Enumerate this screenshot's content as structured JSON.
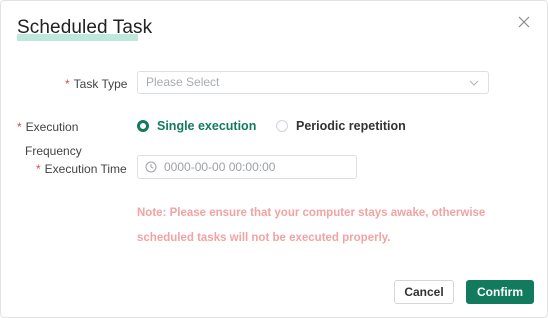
{
  "dialog": {
    "title": "Scheduled Task",
    "close_icon": "close-icon"
  },
  "form": {
    "task_type": {
      "required_mark": "*",
      "label": "Task Type",
      "placeholder": "Please Select"
    },
    "execution_frequency": {
      "required_mark": "*",
      "label_line1": "Execution",
      "label_line2": "Frequency",
      "options": [
        {
          "label": "Single execution",
          "checked": true
        },
        {
          "label": "Periodic repetition",
          "checked": false
        }
      ]
    },
    "execution_time": {
      "required_mark": "*",
      "label": "Execution Time",
      "placeholder": "0000-00-00 00:00:00"
    },
    "note_line1": "Note: Please ensure that your computer stays awake, otherwise",
    "note_line2": "scheduled tasks will not be executed properly."
  },
  "footer": {
    "cancel_label": "Cancel",
    "confirm_label": "Confirm"
  },
  "colors": {
    "accent": "#127b5e",
    "required": "#e24b4b",
    "note": "#f2a3a3",
    "title_highlight": "#bfe8dc"
  }
}
